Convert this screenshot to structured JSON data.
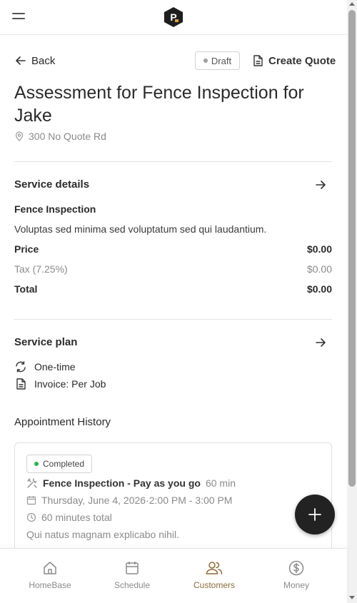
{
  "header": {
    "logo_letter": "P"
  },
  "actions": {
    "back_label": "Back",
    "status_badge": "Draft",
    "create_quote_label": "Create Quote"
  },
  "page": {
    "title": "Assessment for Fence Inspection for Jake",
    "address": "300 No Quote Rd"
  },
  "service_details": {
    "heading": "Service details",
    "service_name": "Fence Inspection",
    "description": "Voluptas sed minima sed voluptatum sed qui laudantium.",
    "price_label": "Price",
    "price_value": "$0.00",
    "tax_label": "Tax (7.25%)",
    "tax_value": "$0.00",
    "total_label": "Total",
    "total_value": "$0.00"
  },
  "service_plan": {
    "heading": "Service plan",
    "frequency": "One-time",
    "invoice": "Invoice: Per Job"
  },
  "appointment_history": {
    "heading": "Appointment History",
    "items": [
      {
        "status": "Completed",
        "service": "Fence Inspection - Pay as you go",
        "duration": "60 min",
        "date": "Thursday, June 4, 2026",
        "separator": "·",
        "time_range": "2:00 PM - 3:00 PM",
        "total_time": "60 minutes total",
        "note": "Qui natus magnam explicabo nihil."
      }
    ]
  },
  "bottom_nav": {
    "items": [
      {
        "label": "HomeBase",
        "icon": "home-icon"
      },
      {
        "label": "Schedule",
        "icon": "calendar-icon"
      },
      {
        "label": "Customers",
        "icon": "users-icon",
        "active": true
      },
      {
        "label": "Money",
        "icon": "dollar-circle-icon"
      }
    ]
  },
  "colors": {
    "accent_active": "#8a6a3a",
    "completed_dot": "#2bb24c",
    "draft_dot": "#a0a0a0",
    "fab": "#222222"
  }
}
